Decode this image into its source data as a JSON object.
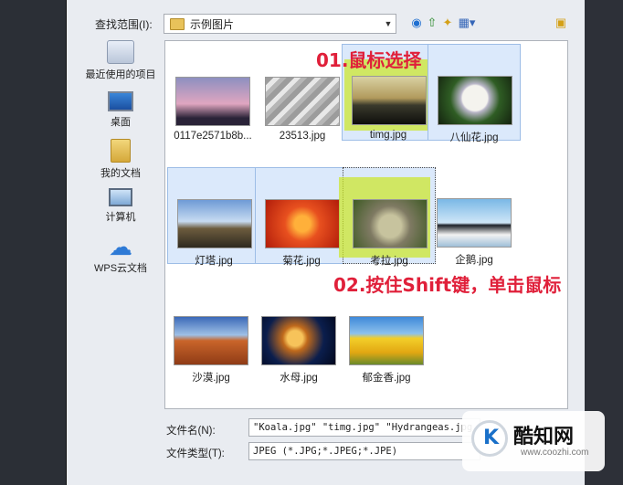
{
  "dialog": {
    "look_in_label": "查找范围(I):",
    "look_in_value": "示例图片",
    "places": [
      {
        "label": "最近使用的项目",
        "icon": "recent-items-icon"
      },
      {
        "label": "桌面",
        "icon": "desktop-icon"
      },
      {
        "label": "我的文档",
        "icon": "documents-icon"
      },
      {
        "label": "计算机",
        "icon": "computer-icon"
      },
      {
        "label": "WPS云文档",
        "icon": "cloud-icon"
      }
    ],
    "files": [
      {
        "name": "0117e2571b8b...",
        "selected": false
      },
      {
        "name": "23513.jpg",
        "selected": false
      },
      {
        "name": "timg.jpg",
        "selected": true
      },
      {
        "name": "八仙花.jpg",
        "selected": true
      },
      {
        "name": "灯塔.jpg",
        "selected": true
      },
      {
        "name": "菊花.jpg",
        "selected": true
      },
      {
        "name": "考拉.jpg",
        "selected": true,
        "focused": true
      },
      {
        "name": "企鹅.jpg",
        "selected": false
      },
      {
        "name": "沙漠.jpg",
        "selected": false
      },
      {
        "name": "水母.jpg",
        "selected": false
      },
      {
        "name": "郁金香.jpg",
        "selected": false
      }
    ],
    "file_name_label": "文件名(N):",
    "file_name_value": "\"Koala.jpg\" \"timg.jpg\" \"Hydrangeas.jpg",
    "file_type_label": "文件类型(T):",
    "file_type_value": "JPEG (*.JPG;*.JPEG;*.JPE)"
  },
  "annotations": {
    "step1": "01.鼠标选择",
    "step2": "02.按住Shift键，单击鼠标"
  },
  "watermark": {
    "title": "酷知网",
    "url": "www.coozhi.com"
  },
  "colors": {
    "annotation_red": "#e0203a",
    "highlight_yellow": "#cce628",
    "selection_blue": "#dbe9fb"
  }
}
